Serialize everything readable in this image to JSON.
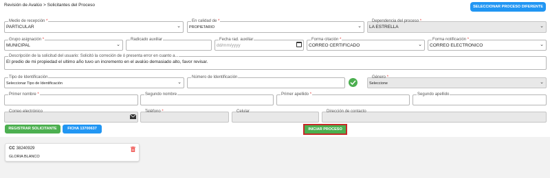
{
  "header": {
    "title": "Revisión de Avalúo > Solicitantes del Proceso",
    "change_process_button": "SELECCIONAR PROCESO DIFERENTE"
  },
  "form": {
    "medio_recepcion": {
      "label": "Medio de recepción",
      "value": "PARTICULAR"
    },
    "calidad": {
      "label": "En calidad de",
      "value": "PROPIETARIO"
    },
    "dependencia": {
      "label": "Dependencia del proceso",
      "value": "LA ESTRELLA"
    },
    "grupo": {
      "label": "Grupo asignación",
      "value": "MUNICIPAL"
    },
    "radicado": {
      "label": "Radicado auxiliar",
      "value": ""
    },
    "fecha": {
      "label": "Fecha rad. auxiliar",
      "placeholder": "dd/mm/yyyy"
    },
    "forma_citacion": {
      "label": "Forma citación",
      "value": "CORREO CERTIFICADO"
    },
    "forma_notificacion": {
      "label": "Forma notificación",
      "value": "CORREO ELECTRONICO"
    },
    "descripcion": {
      "label": "Descripción de la solicitud del usuario: Solicitó la correción de ó presenta error en cuanto a...",
      "value": "El predio de mi propiedad el ultimo año tuvo un incremento en el avalúo demasiado alto, favor revisar."
    },
    "tipo_identificacion": {
      "label": "Tipo de Identificación",
      "value": "Seleccionar Tipo de Identificación"
    },
    "numero_identificacion": {
      "label": "Número de Identificación",
      "value": ""
    },
    "genero": {
      "label": "Género",
      "value": "Seleccione"
    },
    "primer_nombre": {
      "label": "Primer nombre",
      "value": ""
    },
    "segundo_nombre": {
      "label": "Segundo nombre",
      "value": ""
    },
    "primer_apellido": {
      "label": "Primer apellido",
      "value": ""
    },
    "segundo_apellido": {
      "label": "Segundo apellido",
      "value": ""
    },
    "correo": {
      "label": "Correo electrónico",
      "value": ""
    },
    "telefono": {
      "label": "Teléfono",
      "value": ""
    },
    "celular": {
      "label": "Celular",
      "value": ""
    },
    "direccion": {
      "label": "Dirección de contacto",
      "value": ""
    }
  },
  "actions": {
    "registrar": "REGISTRAR SOLICITANTE",
    "ficha": "FICHA 13700637",
    "iniciar": "INICIAR PROCESO"
  },
  "applicants": [
    {
      "doc_type": "CC",
      "doc_number": "38240929",
      "name": "GLORIA BLANCO"
    }
  ],
  "colors": {
    "primary_blue": "#2196f3",
    "success_green": "#4caf50",
    "required_red": "#e53935",
    "highlight_border": "#c62828",
    "delete_icon": "#ef5350"
  }
}
